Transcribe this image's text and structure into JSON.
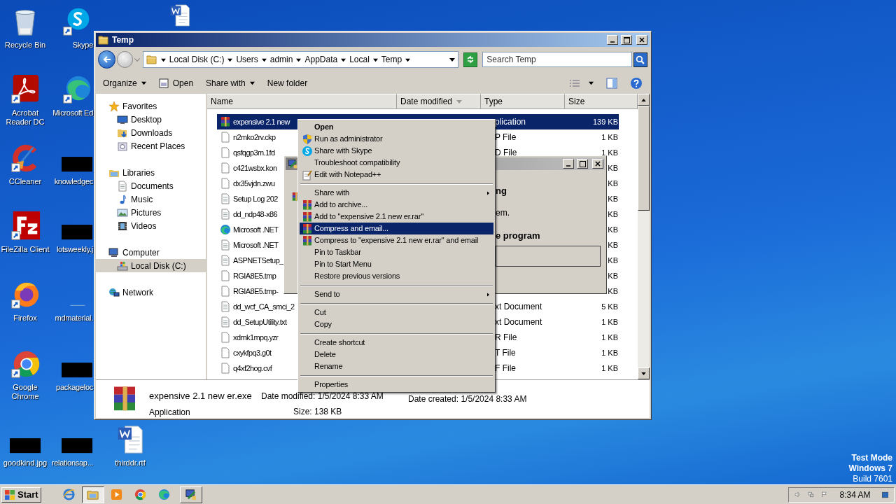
{
  "desktop": {
    "columns": [
      [
        {
          "label": "Recycle Bin",
          "kind": "recycle",
          "shortcut": false
        },
        {
          "label": "Acrobat Reader DC",
          "kind": "acrobat",
          "shortcut": true
        },
        {
          "label": "CCleaner",
          "kind": "ccleaner",
          "shortcut": true
        },
        {
          "label": "FileZilla Client",
          "kind": "filezilla",
          "shortcut": true
        },
        {
          "label": "Firefox",
          "kind": "firefox",
          "shortcut": true
        },
        {
          "label": "Google Chrome",
          "kind": "chrome",
          "shortcut": true
        },
        {
          "label": "goodkind.jpg",
          "kind": "thumbnail",
          "shortcut": false
        }
      ],
      [
        {
          "label": "Skype",
          "kind": "skype",
          "shortcut": true
        },
        {
          "label": "Microsoft Ed",
          "kind": "edge",
          "shortcut": true
        },
        {
          "label": "knowledgec",
          "kind": "thumbnail",
          "shortcut": false
        },
        {
          "label": "lotsweekly.j",
          "kind": "thumbnail",
          "shortcut": false
        },
        {
          "label": "mdmaterial.",
          "kind": "faint",
          "shortcut": false
        },
        {
          "label": "packageloc",
          "kind": "thumbnail",
          "shortcut": false
        },
        {
          "label": "relationsap...",
          "kind": "thumbnail",
          "shortcut": false
        }
      ],
      [
        {
          "kind": "word",
          "shortcut": false
        },
        {
          "label": "thirddr.rtf",
          "kind": "word",
          "shortcut": false
        }
      ]
    ],
    "system_notice": [
      "Test Mode",
      "Windows 7",
      "Build 7601"
    ]
  },
  "explorer": {
    "title": "Temp",
    "breadcrumb": [
      "Local Disk (C:)",
      "Users",
      "admin",
      "AppData",
      "Local",
      "Temp"
    ],
    "search": {
      "placeholder": "Search Temp"
    },
    "toolbar": [
      {
        "label": "Organize",
        "kind": "menu"
      },
      {
        "label": "Open",
        "kind": "open"
      },
      {
        "label": "Share with",
        "kind": "menu"
      },
      {
        "label": "New folder",
        "kind": "plain"
      }
    ],
    "nav": [
      {
        "label": "Favorites",
        "kind": "star",
        "selected": false,
        "children": [
          {
            "label": "Desktop",
            "kind": "desktop",
            "selected": false
          },
          {
            "label": "Downloads",
            "kind": "downloads",
            "selected": false
          },
          {
            "label": "Recent Places",
            "kind": "recent",
            "selected": false
          }
        ]
      },
      {
        "label": "Libraries",
        "kind": "libraries",
        "selected": false,
        "children": [
          {
            "label": "Documents",
            "kind": "documents",
            "selected": false
          },
          {
            "label": "Music",
            "kind": "music",
            "selected": false
          },
          {
            "label": "Pictures",
            "kind": "pictures",
            "selected": false
          },
          {
            "label": "Videos",
            "kind": "videos",
            "selected": false
          }
        ]
      },
      {
        "label": "Computer",
        "kind": "computer",
        "selected": false,
        "children": [
          {
            "label": "Local Disk (C:)",
            "kind": "disk",
            "selected": true
          }
        ]
      },
      {
        "label": "Network",
        "kind": "network",
        "selected": false
      }
    ],
    "columns": [
      {
        "label": "Name",
        "sorted": false
      },
      {
        "label": "Date modified",
        "sorted": true
      },
      {
        "label": "Type",
        "sorted": false
      },
      {
        "label": "Size",
        "sorted": false
      }
    ],
    "files": [
      {
        "name": "expensive 2.1 new",
        "type": "plication",
        "size": "139 KB",
        "kind": "rar",
        "selected": true
      },
      {
        "name": "n2mko2rv.ckp",
        "type": "P File",
        "size": "1 KB",
        "kind": "blank",
        "selected": false
      },
      {
        "name": "qsfqgp3m.1fd",
        "type": "D File",
        "size": "1 KB",
        "kind": "blank",
        "selected": false
      },
      {
        "name": "c421wsbx.kon",
        "size": "KB",
        "kind": "blank",
        "selected": false
      },
      {
        "name": "dx35vjdn.zwu",
        "size": "KB",
        "kind": "blank",
        "selected": false
      },
      {
        "name": "Setup Log 202",
        "size": "KB",
        "kind": "text",
        "selected": false
      },
      {
        "name": "dd_ndp48-x86",
        "size": "KB",
        "kind": "text",
        "selected": false
      },
      {
        "name": "Microsoft .NET",
        "size": "KB",
        "kind": "edge",
        "selected": false
      },
      {
        "name": "Microsoft .NET",
        "size": "KB",
        "kind": "text",
        "selected": false
      },
      {
        "name": "ASPNETSetup_",
        "size": "KB",
        "kind": "text",
        "selected": false
      },
      {
        "name": "RGIA8E5.tmp",
        "size": "KB",
        "kind": "blank",
        "selected": false
      },
      {
        "name": "RGIA8E5.tmp-",
        "size": "KB",
        "kind": "blank",
        "selected": false
      },
      {
        "name": "dd_wcf_CA_smci_2",
        "type": "xt Document",
        "size": "5 KB",
        "kind": "text",
        "selected": false
      },
      {
        "name": "dd_SetupUtility.txt",
        "type": "xt Document",
        "size": "1 KB",
        "kind": "text",
        "selected": false
      },
      {
        "name": "xdmk1mpq.yzr",
        "type": "R File",
        "size": "1 KB",
        "kind": "blank",
        "selected": false
      },
      {
        "name": "cxykfpq3.g0t",
        "type": "T File",
        "size": "1 KB",
        "kind": "blank",
        "selected": false
      },
      {
        "name": "q4xf2hog.cvf",
        "type": "F File",
        "size": "1 KB",
        "kind": "blank",
        "selected": false
      }
    ],
    "details": {
      "name": "expensive 2.1 new er.exe",
      "type": "Application",
      "modified": "Date modified: 1/5/2024 8:33 AM",
      "size": "Size: 138 KB",
      "created": "Date created: 1/5/2024 8:33 AM"
    }
  },
  "dialog": {
    "fragments": [
      {
        "text": "ng",
        "bold": true
      },
      {
        "text": "em.",
        "bold": false
      },
      {
        "text": "e program",
        "bold": true
      }
    ]
  },
  "context_menu": [
    {
      "label": "Open",
      "kind": "plain",
      "default": true,
      "submenu": false,
      "selected": false
    },
    {
      "label": "Run as administrator",
      "kind": "shield",
      "default": false,
      "submenu": false,
      "selected": false
    },
    {
      "label": "Share with Skype",
      "kind": "skype",
      "default": false,
      "submenu": false,
      "selected": false
    },
    {
      "label": "Troubleshoot compatibility",
      "kind": "plain",
      "default": false,
      "submenu": false,
      "selected": false
    },
    {
      "label": "Edit with Notepad++",
      "kind": "notepad",
      "default": false,
      "submenu": false,
      "selected": false
    },
    {
      "kind": "separator"
    },
    {
      "label": "Share with",
      "kind": "plain",
      "default": false,
      "submenu": true,
      "selected": false
    },
    {
      "label": "Add to archive...",
      "kind": "archive",
      "default": false,
      "submenu": false,
      "selected": false
    },
    {
      "label": "Add to \"expensive 2.1 new er.rar\"",
      "kind": "archive",
      "default": false,
      "submenu": false,
      "selected": false
    },
    {
      "label": "Compress and email...",
      "kind": "archive",
      "default": false,
      "submenu": false,
      "selected": true
    },
    {
      "label": "Compress to \"expensive 2.1 new er.rar\" and email",
      "kind": "archive",
      "default": false,
      "submenu": false,
      "selected": false
    },
    {
      "label": "Pin to Taskbar",
      "kind": "plain",
      "default": false,
      "submenu": false,
      "selected": false
    },
    {
      "label": "Pin to Start Menu",
      "kind": "plain",
      "default": false,
      "submenu": false,
      "selected": false
    },
    {
      "label": "Restore previous versions",
      "kind": "plain",
      "default": false,
      "submenu": false,
      "selected": false
    },
    {
      "kind": "separator"
    },
    {
      "label": "Send to",
      "kind": "plain",
      "default": false,
      "submenu": true,
      "selected": false
    },
    {
      "kind": "separator"
    },
    {
      "label": "Cut",
      "kind": "plain",
      "default": false,
      "submenu": false,
      "selected": false
    },
    {
      "label": "Copy",
      "kind": "plain",
      "default": false,
      "submenu": false,
      "selected": false
    },
    {
      "kind": "separator"
    },
    {
      "label": "Create shortcut",
      "kind": "plain",
      "default": false,
      "submenu": false,
      "selected": false
    },
    {
      "label": "Delete",
      "kind": "plain",
      "default": false,
      "submenu": false,
      "selected": false
    },
    {
      "label": "Rename",
      "kind": "plain",
      "default": false,
      "submenu": false,
      "selected": false
    },
    {
      "kind": "separator"
    },
    {
      "label": "Properties",
      "kind": "plain",
      "default": false,
      "submenu": false,
      "selected": false
    }
  ],
  "taskbar": {
    "start": "Start",
    "items": [
      {
        "kind": "ie",
        "selected": false
      },
      {
        "kind": "explorer",
        "selected": true
      },
      {
        "kind": "media",
        "selected": false
      },
      {
        "kind": "chrome",
        "selected": false
      },
      {
        "kind": "edge",
        "selected": false
      },
      {
        "kind": "app",
        "selected": false
      }
    ],
    "clock": "8:34 AM"
  }
}
